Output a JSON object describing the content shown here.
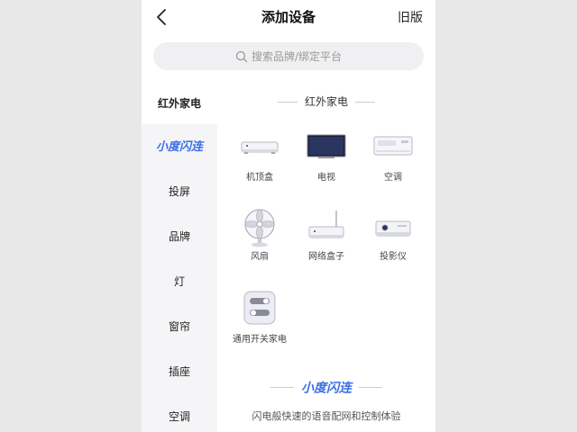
{
  "header": {
    "title": "添加设备",
    "old_version": "旧版"
  },
  "search": {
    "placeholder": "搜索品牌/绑定平台"
  },
  "sidebar": {
    "items": [
      {
        "label": "红外家电"
      },
      {
        "label": "小度闪连"
      },
      {
        "label": "投屏"
      },
      {
        "label": "品牌"
      },
      {
        "label": "灯"
      },
      {
        "label": "窗帘"
      },
      {
        "label": "插座"
      },
      {
        "label": "空调"
      }
    ]
  },
  "section": {
    "title": "红外家电",
    "devices": [
      {
        "label": "机顶盒",
        "icon": "set-top-box-icon"
      },
      {
        "label": "电视",
        "icon": "tv-icon"
      },
      {
        "label": "空调",
        "icon": "air-conditioner-icon"
      },
      {
        "label": "风扇",
        "icon": "fan-icon"
      },
      {
        "label": "网络盒子",
        "icon": "network-box-icon"
      },
      {
        "label": "投影仪",
        "icon": "projector-icon"
      },
      {
        "label": "通用开关家电",
        "icon": "switch-icon"
      }
    ]
  },
  "promo": {
    "logo": "小度闪连",
    "subtitle": "闪电般快速的语音配网和控制体验"
  },
  "colors": {
    "accent": "#3a6ee8",
    "background": "#f5f5f7"
  }
}
